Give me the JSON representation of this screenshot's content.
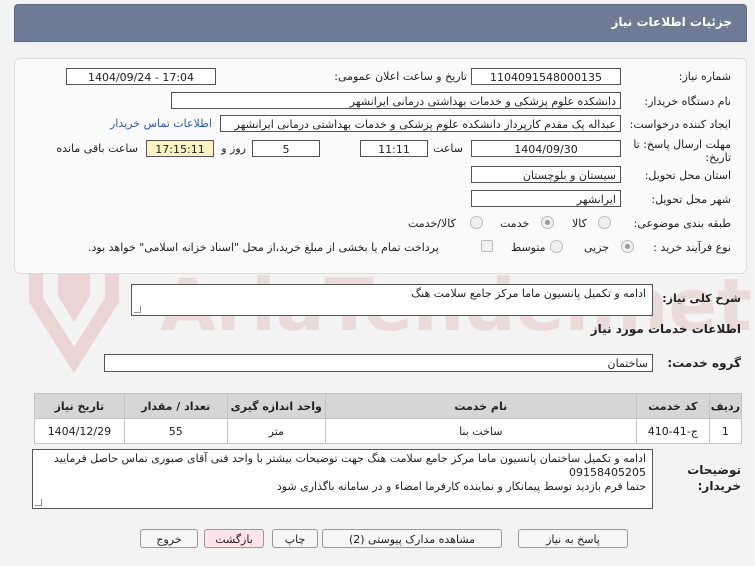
{
  "header": {
    "title": "جزئیات اطلاعات نیاز"
  },
  "form": {
    "need_number_label": "شماره نیاز:",
    "need_number": "1104091548000135",
    "announce_label": "تاریخ و ساعت اعلان عمومی:",
    "announce_value": "1404/09/24 - 17:04",
    "buyer_label": "نام دستگاه خریدار:",
    "buyer_value": "دانشکده علوم پزشکی و خدمات بهداشتی درمانی ایرانشهر",
    "creator_label": "ایجاد کننده درخواست:",
    "creator_value": "عبداله پک مقدم کارپرداز دانشکده علوم پزشکی و خدمات بهداشتی درمانی ایرانشهر",
    "contact_link": "اطلاعات تماس خریدار",
    "deadline_label": "مهلت ارسال پاسخ: تا تاریخ:",
    "deadline_date": "1404/09/30",
    "time_label": "ساعت",
    "deadline_time": "11:11",
    "days_value": "5",
    "days_label": "روز و",
    "remaining_time": "17:15:11",
    "remaining_label": "ساعت باقی مانده",
    "province_label": "استان محل تحویل:",
    "province_value": "سیستان و بلوچستان",
    "city_label": "شهر محل تحویل:",
    "city_value": "ایرانشهر",
    "category_label": "طبقه بندی موضوعی:",
    "category_options": [
      "کالا",
      "خدمت",
      "کالا/خدمت"
    ],
    "category_selected": "خدمت",
    "process_label": "نوع فرآیند خرید :",
    "process_options": [
      "جزیی",
      "متوسط"
    ],
    "process_selected": "جزیی",
    "payment_text": "پرداخت تمام یا بخشی از مبلغ خرید،از محل \"اسناد خزانه اسلامی\" خواهد بود."
  },
  "description": {
    "label": "شرح کلی نیاز:",
    "value": "ادامه و تکمیل پانسیون ماما مرکز جامع سلامت هنگ"
  },
  "services": {
    "section_title": "اطلاعات خدمات مورد نیاز",
    "group_label": "گروه خدمت:",
    "group_value": "ساختمان",
    "columns": [
      "ردیف",
      "کد خدمت",
      "نام خدمت",
      "واحد اندازه گیری",
      "تعداد / مقدار",
      "تاریخ نیاز"
    ],
    "rows": [
      {
        "row": "1",
        "code": "ج-41-410",
        "name": "ساخت بنا",
        "unit": "متر",
        "qty": "55",
        "date": "1404/12/29"
      }
    ]
  },
  "buyer_notes": {
    "label": "توضیحات خریدار:",
    "line1": "ادامه و تکمیل ساختمان پانسیون ماما مرکز جامع سلامت هنگ جهت توضیحات بیشتر با واحد فنی آقای صبوری تماس حاصل فرمایید 09158405205",
    "line2": "حتما فرم بازدید توسط پیمانکار و نماینده کارفرما امضاء و در سامانه باگذاری شود"
  },
  "buttons": {
    "reply": "پاسخ به نیاز",
    "docs": "مشاهده مدارک پیوستی (2)",
    "print": "چاپ",
    "back": "بازگشت",
    "exit": "خروج"
  },
  "watermark": {
    "text": "AriaTender.net"
  },
  "colors": {
    "header": "#6d7c94",
    "link": "#2a5db0",
    "watermark": "#e6c8c8"
  }
}
